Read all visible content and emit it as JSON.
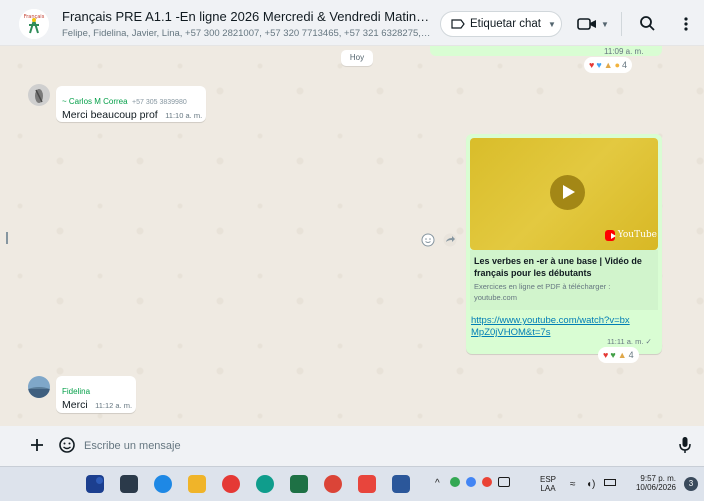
{
  "header": {
    "title": "Français PRE A1.1 -En ligne 2026  Mercredi &  Vendredi Matin 8 à 10 du ...",
    "subtitle": "Felipe, Fidelina, Javier, Lina, +57 300 2821007, +57 320 7713465, +57 321 6328275, +57 ...",
    "label_chat": "Etiquetar chat",
    "avatar_logo_text": "Français"
  },
  "chat": {
    "top_message": {
      "time": "11:09 a. m.",
      "reaction_count": "4"
    },
    "day_chip": "Hoy",
    "messages": [
      {
        "sender": "~ Carlos M Correa",
        "phone": "+57 305 3839980",
        "text": "Merci beaucoup prof",
        "time": "11:10 a. m."
      },
      {
        "sender": "Fidelina",
        "text": "Merci",
        "time": "11:12 a. m."
      }
    ],
    "outgoing": {
      "preview_brand": "YouTube",
      "link_title": "Les verbes en -er à une base | Vidéo de français pour les débutants",
      "link_description": "Exercices en ligne et PDF à télécharger :",
      "link_domain": "youtube.com",
      "url": "https://www.youtube.com/watch?v=bxMpZ0jVHOM&t=7s",
      "time": "11:11 a. m.",
      "reaction_count": "4"
    }
  },
  "composer": {
    "placeholder": "Escribe un mensaje"
  },
  "taskbar": {
    "lang_top": "ESP",
    "lang_bottom": "LAA",
    "time": "9:57 p. m.",
    "date": "10/06/2026",
    "notif_count": "3"
  },
  "colors": {
    "accent_green": "#06a04a",
    "out_bubble": "#d9fdd3",
    "chat_bg": "#efeae2",
    "link_blue": "#027eb5"
  }
}
